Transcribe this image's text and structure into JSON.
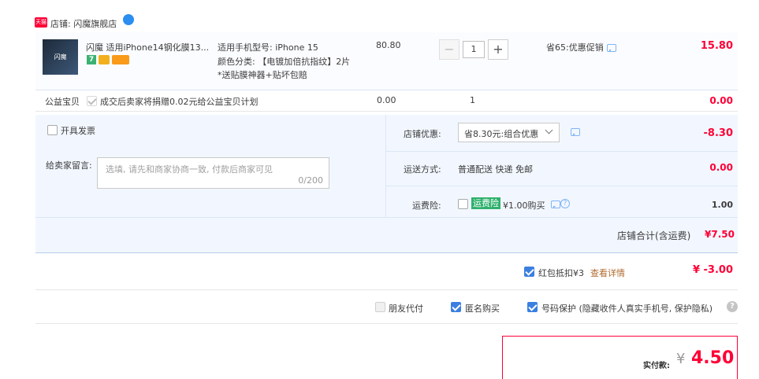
{
  "shop": {
    "badge": "天猫",
    "label": "店铺: 闪魔旗舰店"
  },
  "item": {
    "title": "闪魔 适用iPhone14钢化膜13...",
    "thumb_text": "闪魔",
    "model_label": "适用手机型号: iPhone 15",
    "color_label": "颜色分类: 【电镀加倍抗指纹】2片*送贴膜神器+贴坏包赔",
    "unit_price": "80.80",
    "quantity": "1",
    "minus": "−",
    "plus": "+",
    "promo": "省65:优惠促销",
    "subtotal": "15.80"
  },
  "charity": {
    "label": "公益宝贝",
    "text": "成交后卖家将捐赠0.02元给公益宝贝计划",
    "price": "0.00",
    "qty": "1",
    "total": "0.00"
  },
  "invoice": {
    "label": "开具发票"
  },
  "message": {
    "label": "给卖家留言:",
    "placeholder": "选填, 请先和商家协商一致, 付款后商家可见",
    "counter": "0/200"
  },
  "shop_discount": {
    "label": "店铺优惠:",
    "select_value": "省8.30元:组合优惠",
    "amount": "-8.30"
  },
  "shipping": {
    "label": "运送方式:",
    "value": "普通配送 快递 免邮",
    "amount": "0.00"
  },
  "freight_insurance": {
    "label": "运费险:",
    "tag": "运费险",
    "price": "¥1.00购买",
    "amount": "1.00"
  },
  "shop_total": {
    "label": "店铺合计(含运费)",
    "amount": "¥7.50"
  },
  "red_packet": {
    "label": "红包抵扣¥3",
    "link": "查看详情",
    "amount": "¥ -3.00"
  },
  "options": {
    "friend_pay": "朋友代付",
    "anonymous": "匿名购买",
    "number_protect": "号码保护 (隐藏收件人真实手机号, 保护隐私)",
    "help": "?"
  },
  "payment": {
    "label": "实付款:",
    "currency": "¥",
    "amount": "4.50"
  },
  "colors": {
    "accent": "#ff0036",
    "brand_blue": "#3b7fe0",
    "panel": "#f2f7ff"
  }
}
